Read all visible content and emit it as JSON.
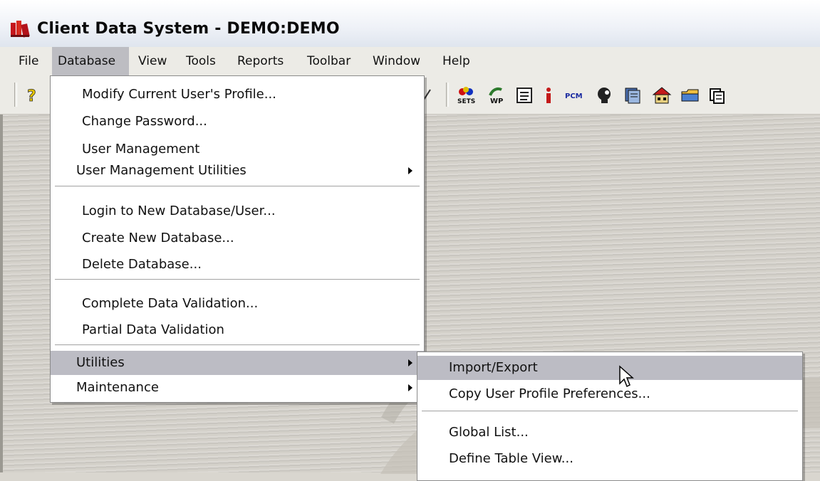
{
  "window": {
    "title": "Client Data System - DEMO:DEMO",
    "icon": "books-app-icon"
  },
  "menubar": {
    "items": [
      {
        "label": "File"
      },
      {
        "label": "Database"
      },
      {
        "label": "View"
      },
      {
        "label": "Tools"
      },
      {
        "label": "Reports"
      },
      {
        "label": "Toolbar"
      },
      {
        "label": "Window"
      },
      {
        "label": "Help"
      }
    ]
  },
  "toolbar": {
    "icons": [
      "help-icon",
      "sets-icon",
      "wp-icon",
      "notes-icon",
      "info-icon",
      "pcm-icon",
      "person-icon",
      "documents-icon",
      "house-icon",
      "folder-icon",
      "reports-icon"
    ],
    "sets_label": "SETS",
    "wp_label": "WP",
    "pcm_label": "PCM"
  },
  "database_menu": {
    "items": [
      {
        "label": "Modify Current User's Profile..."
      },
      {
        "label": "Change Password..."
      },
      {
        "label": "User Management"
      },
      {
        "label": "User Management Utilities",
        "submenu": true
      },
      {
        "label": "Login to New Database/User..."
      },
      {
        "label": "Create New Database..."
      },
      {
        "label": "Delete Database..."
      },
      {
        "label": "Complete Data Validation..."
      },
      {
        "label": "Partial Data Validation"
      },
      {
        "label": "Utilities",
        "submenu": true,
        "selected": true
      },
      {
        "label": "Maintenance",
        "submenu": true
      }
    ]
  },
  "utilities_submenu": {
    "items": [
      {
        "label": "Import/Export",
        "selected": true
      },
      {
        "label": "Copy User Profile Preferences..."
      },
      {
        "label": "Global List..."
      },
      {
        "label": "Define Table View..."
      }
    ]
  }
}
